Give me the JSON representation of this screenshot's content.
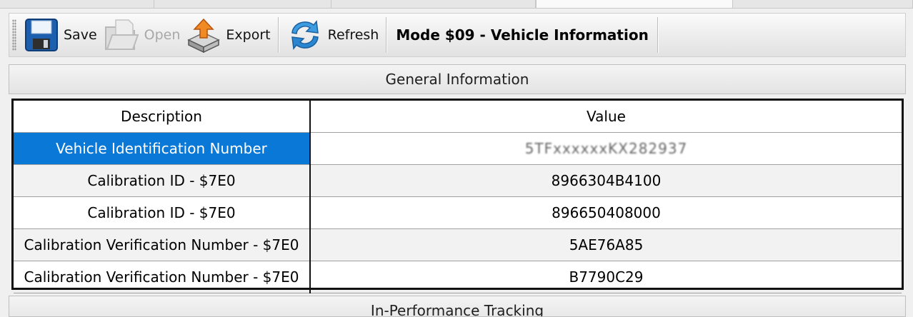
{
  "toolbar": {
    "buttons": [
      {
        "label": "Save",
        "icon": "floppy-disk-icon",
        "enabled": true
      },
      {
        "label": "Open",
        "icon": "open-folder-icon",
        "enabled": false
      },
      {
        "label": "Export",
        "icon": "export-box-icon",
        "enabled": true
      },
      {
        "label": "Refresh",
        "icon": "refresh-arrows-icon",
        "enabled": true
      }
    ],
    "mode_label": "Mode $09 - Vehicle Information"
  },
  "panel": {
    "title": "General Information",
    "columns": [
      "Description",
      "Value"
    ],
    "rows": [
      {
        "description": "Vehicle Identification Number",
        "value": "5TFxxxxxxKX282937",
        "selected": true
      },
      {
        "description": "Calibration ID - $7E0",
        "value": "8966304B4100"
      },
      {
        "description": "Calibration ID - $7E0",
        "value": "896650408000"
      },
      {
        "description": "Calibration Verification Number - $7E0",
        "value": "5AE76A85"
      },
      {
        "description": "Calibration Verification Number - $7E0",
        "value": "B7790C29"
      }
    ]
  },
  "next_panel": {
    "title": "In-Performance Tracking"
  },
  "colors": {
    "selection": "#0a78d7",
    "grid_border": "#111111"
  }
}
